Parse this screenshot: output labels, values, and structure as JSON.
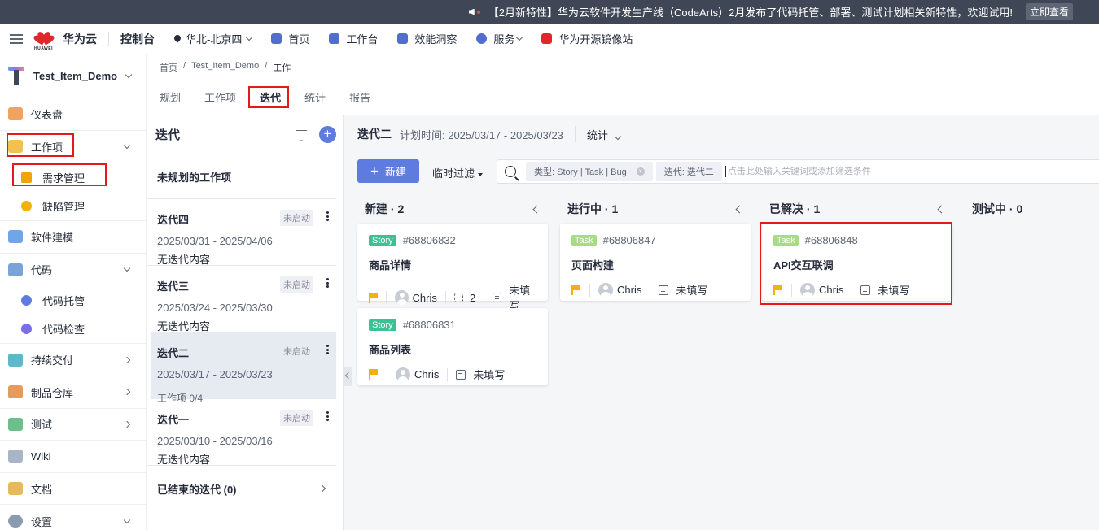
{
  "announcement": {
    "text": "【2月新特性】华为云软件开发生产线（CodeArts）2月发布了代码托管、部署、测试计划相关新特性，欢迎试用!",
    "button": "立即查看"
  },
  "topnav": {
    "logo_text": "HUAWEI",
    "brand": "华为云",
    "console": "控制台",
    "region": "华北-北京四",
    "items": [
      {
        "label": "首页",
        "icon": "home-icon",
        "color": "#526ecc"
      },
      {
        "label": "工作台",
        "icon": "workbench-icon",
        "color": "#526ecc"
      },
      {
        "label": "效能洞察",
        "icon": "insight-icon",
        "color": "#526ecc"
      },
      {
        "label": "服务",
        "icon": "service-icon",
        "color": "#526ecc"
      },
      {
        "label": "华为开源镜像站",
        "icon": "mirror-icon",
        "color": "#e0262a"
      }
    ]
  },
  "sidebar": {
    "project": "Test_Item_Demo",
    "items": [
      {
        "label": "仪表盘",
        "color": "#f0a35c"
      },
      {
        "label": "工作项",
        "color": "#f2c14e"
      },
      {
        "label": "需求管理",
        "color": "#f2a20c"
      },
      {
        "label": "缺陷管理",
        "color": "#f2b20c"
      },
      {
        "label": "软件建模",
        "color": "#6fa6e8"
      },
      {
        "label": "代码",
        "color": "#7aa3d8"
      },
      {
        "label": "代码托管",
        "color": "#5e7ce0"
      },
      {
        "label": "代码检查",
        "color": "#7a6ee8"
      },
      {
        "label": "持续交付",
        "color": "#5fb8c9"
      },
      {
        "label": "制品仓库",
        "color": "#e89a5c"
      },
      {
        "label": "测试",
        "color": "#6cbf8a"
      },
      {
        "label": "Wiki",
        "color": "#a9b4c4"
      },
      {
        "label": "文档",
        "color": "#e8b85c"
      },
      {
        "label": "设置",
        "color": "#8a9bb0"
      }
    ]
  },
  "breadcrumb": {
    "home": "首页",
    "project": "Test_Item_Demo",
    "current": "工作"
  },
  "tabs": [
    "规划",
    "工作项",
    "迭代",
    "统计",
    "报告"
  ],
  "iteration_panel": {
    "title": "迭代",
    "unplanned": "未规划的工作项",
    "iterations": [
      {
        "name": "迭代四",
        "date": "2025/03/31 - 2025/04/06",
        "status": "未启动",
        "content": "无迭代内容"
      },
      {
        "name": "迭代三",
        "date": "2025/03/24 - 2025/03/30",
        "status": "未启动",
        "content": "无迭代内容"
      },
      {
        "name": "迭代二",
        "date": "2025/03/17 - 2025/03/23",
        "status": "未启动",
        "content": "工作项 0/4"
      },
      {
        "name": "迭代一",
        "date": "2025/03/10 - 2025/03/16",
        "status": "未启动",
        "content": "无迭代内容"
      }
    ],
    "ended": "已结束的迭代 (0)"
  },
  "board": {
    "title": "迭代二",
    "plan_time": "计划时间: 2025/03/17 - 2025/03/23",
    "stat": "统计",
    "new_button": "新建",
    "temp_filter": "临时过滤",
    "chips": [
      "类型:   Story  |  Task  |  Bug",
      "迭代:   迭代二"
    ],
    "search_placeholder": "点击此处输入关键词或添加筛选条件",
    "columns": [
      {
        "title": "新建 · 2",
        "cards": [
          {
            "type": "Story",
            "id": "#68806832",
            "title": "商品详情",
            "assignee": "Chris",
            "subtasks": "2",
            "note": "未填写"
          },
          {
            "type": "Story",
            "id": "#68806831",
            "title": "商品列表",
            "assignee": "Chris",
            "note": "未填写"
          }
        ]
      },
      {
        "title": "进行中 · 1",
        "cards": [
          {
            "type": "Task",
            "id": "#68806847",
            "title": "页面构建",
            "assignee": "Chris",
            "note": "未填写"
          }
        ]
      },
      {
        "title": "已解决 · 1",
        "cards": [
          {
            "type": "Task",
            "id": "#68806848",
            "title": "API交互联调",
            "assignee": "Chris",
            "note": "未填写"
          }
        ]
      },
      {
        "title": "测试中 · 0",
        "cards": []
      }
    ],
    "tag_colors": {
      "Story": "#3ac295",
      "Task": "#a6dd82"
    },
    "highlight_color": "#e41a1a"
  }
}
